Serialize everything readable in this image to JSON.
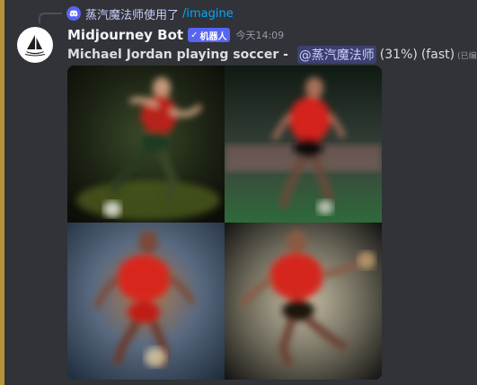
{
  "reply": {
    "user": "蒸汽魔法师使用了",
    "command": "/imagine"
  },
  "message": {
    "author": "Midjourney Bot",
    "bot_tag": "机器人",
    "timestamp": "今天14:09",
    "prompt": "Michael Jordan playing soccer",
    "separator": " - ",
    "mention": "@蒸汽魔法师",
    "progress": "(31%)",
    "mode": "(fast)",
    "edited": "(已编辑)"
  },
  "icons": {
    "reply_avatar": "discord-icon",
    "bot_avatar": "midjourney-boat-icon",
    "verified": "check-icon"
  },
  "colors": {
    "background": "#313338",
    "accent_bar": "#b8923a",
    "bot_tag": "#5865f2",
    "mention": "#c9cdfb",
    "link": "#00a8fc"
  }
}
